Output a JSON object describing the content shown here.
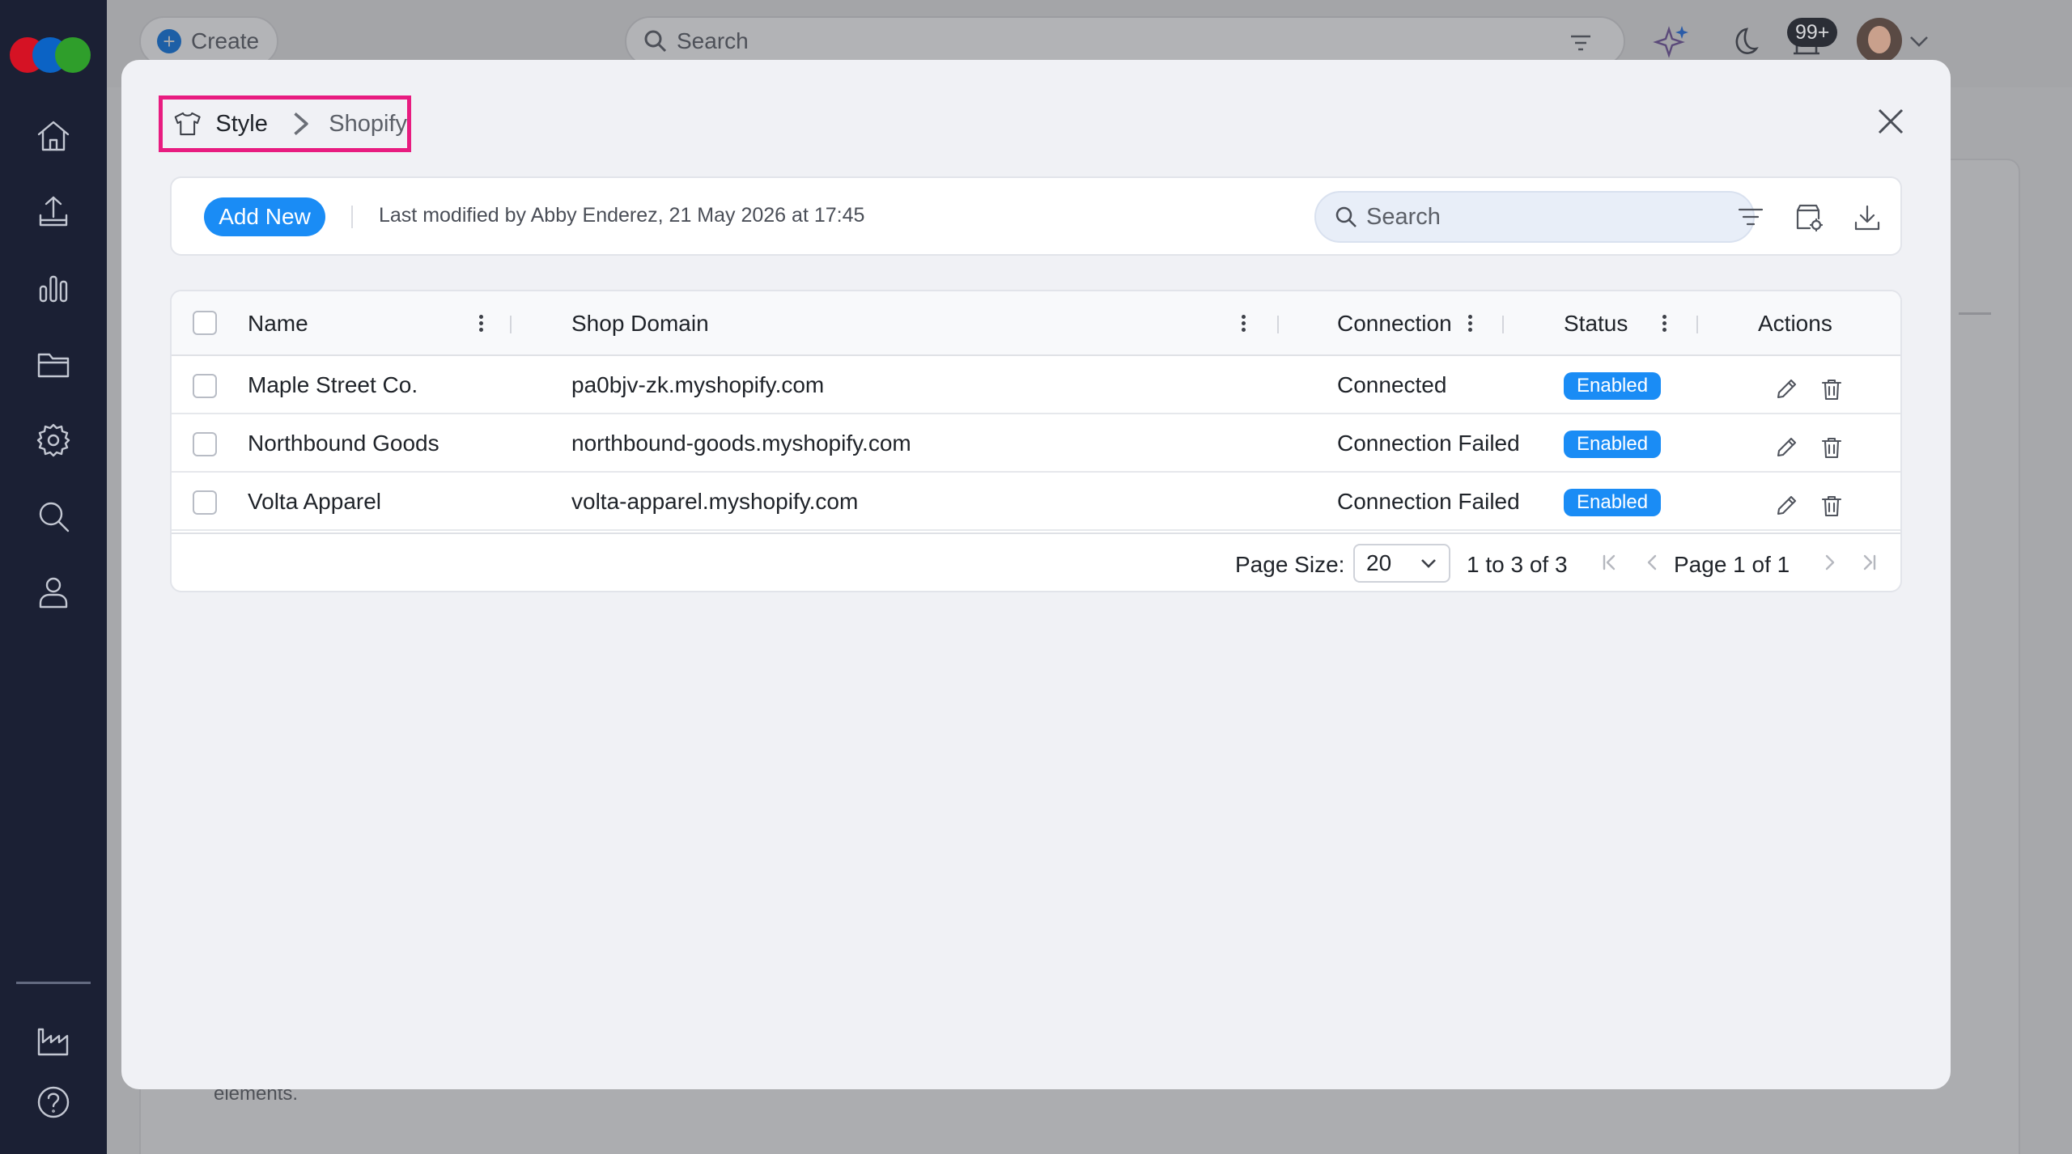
{
  "topbar": {
    "create_label": "Create",
    "search_placeholder": "Search",
    "notifications_badge": "99+"
  },
  "background": {
    "partial_text": "elements."
  },
  "sidebar": {
    "items": [
      {
        "icon": "home-icon"
      },
      {
        "icon": "upload-icon"
      },
      {
        "icon": "bar-chart-icon"
      },
      {
        "icon": "folder-icon"
      },
      {
        "icon": "settings-icon"
      },
      {
        "icon": "search-icon"
      },
      {
        "icon": "user-icon"
      },
      {
        "icon": "factory-icon"
      },
      {
        "icon": "help-icon"
      }
    ]
  },
  "modal": {
    "breadcrumb": {
      "icon": "t-shirt-icon",
      "parent": "Style",
      "current": "Shopify"
    },
    "toolbar": {
      "add_new_label": "Add New",
      "last_modified": "Last modified by Abby Enderez, 21 May 2026 at 17:45",
      "search_placeholder": "Search"
    },
    "table": {
      "columns": [
        "Name",
        "Shop Domain",
        "Connection",
        "Status",
        "Actions"
      ],
      "rows": [
        {
          "name": "Maple Street Co.",
          "domain": "pa0bjv-zk.myshopify.com",
          "connection": "Connected",
          "status": "Enabled"
        },
        {
          "name": "Northbound Goods",
          "domain": "northbound-goods.myshopify.com",
          "connection": "Connection Failed",
          "status": "Enabled"
        },
        {
          "name": "Volta Apparel",
          "domain": "volta-apparel.myshopify.com",
          "connection": "Connection Failed",
          "status": "Enabled"
        }
      ]
    },
    "pagination": {
      "page_size_label": "Page Size:",
      "page_size_value": "20",
      "range": "1 to 3 of 3",
      "page_text": "Page 1 of 1"
    }
  },
  "colors": {
    "accent": "#1a8cf5",
    "sidebar_bg": "#1b2034",
    "highlight_border": "#e81c80"
  }
}
